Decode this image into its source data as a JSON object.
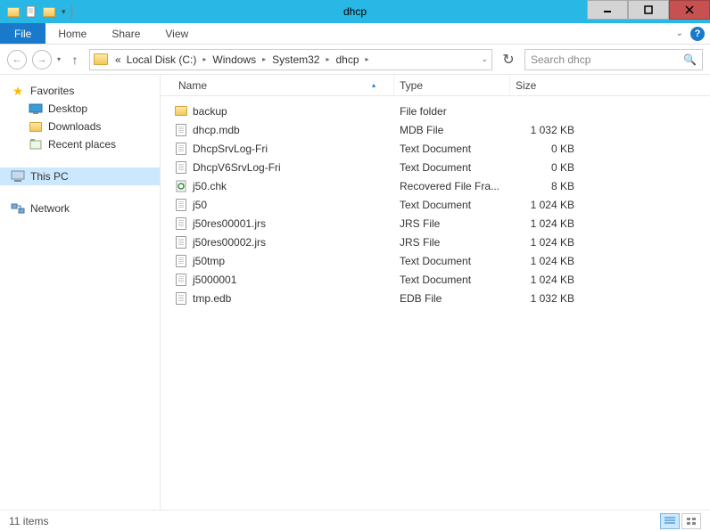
{
  "window": {
    "title": "dhcp"
  },
  "ribbon": {
    "file": "File",
    "home": "Home",
    "share": "Share",
    "view": "View"
  },
  "breadcrumb": {
    "prefix": "«",
    "items": [
      "Local Disk (C:)",
      "Windows",
      "System32",
      "dhcp"
    ]
  },
  "search": {
    "placeholder": "Search dhcp"
  },
  "sidebar": {
    "favorites": {
      "label": "Favorites",
      "items": [
        "Desktop",
        "Downloads",
        "Recent places"
      ]
    },
    "thispc": "This PC",
    "network": "Network"
  },
  "columns": {
    "name": "Name",
    "type": "Type",
    "size": "Size"
  },
  "files": [
    {
      "icon": "folder",
      "name": "backup",
      "type": "File folder",
      "size": ""
    },
    {
      "icon": "doc",
      "name": "dhcp.mdb",
      "type": "MDB File",
      "size": "1 032 KB"
    },
    {
      "icon": "doc",
      "name": "DhcpSrvLog-Fri",
      "type": "Text Document",
      "size": "0 KB"
    },
    {
      "icon": "doc",
      "name": "DhcpV6SrvLog-Fri",
      "type": "Text Document",
      "size": "0 KB"
    },
    {
      "icon": "chk",
      "name": "j50.chk",
      "type": "Recovered File Fra...",
      "size": "8 KB"
    },
    {
      "icon": "doc",
      "name": "j50",
      "type": "Text Document",
      "size": "1 024 KB"
    },
    {
      "icon": "doc",
      "name": "j50res00001.jrs",
      "type": "JRS File",
      "size": "1 024 KB"
    },
    {
      "icon": "doc",
      "name": "j50res00002.jrs",
      "type": "JRS File",
      "size": "1 024 KB"
    },
    {
      "icon": "doc",
      "name": "j50tmp",
      "type": "Text Document",
      "size": "1 024 KB"
    },
    {
      "icon": "doc",
      "name": "j5000001",
      "type": "Text Document",
      "size": "1 024 KB"
    },
    {
      "icon": "doc",
      "name": "tmp.edb",
      "type": "EDB File",
      "size": "1 032 KB"
    }
  ],
  "status": {
    "count": "11 items"
  }
}
